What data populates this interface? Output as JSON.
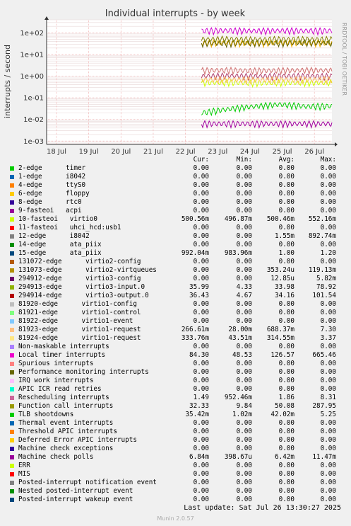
{
  "chart_data": {
    "type": "line",
    "title": "Individual interrupts - by week",
    "ylabel": "interrupts / second",
    "side_text": "RRDTOOL / TOBI OETIKER",
    "y_scale": "log",
    "ylim": [
      0.0007,
      400
    ],
    "y_ticks": [
      {
        "value": 100,
        "label": "1e+02"
      },
      {
        "value": 10,
        "label": "1e+01"
      },
      {
        "value": 1,
        "label": "1e+00"
      },
      {
        "value": 0.1,
        "label": "1e-01"
      },
      {
        "value": 0.01,
        "label": "1e-02"
      },
      {
        "value": 0.001,
        "label": "1e-03"
      }
    ],
    "x_ticks": [
      "18 Jul",
      "19 Jul",
      "20 Jul",
      "21 Jul",
      "22 Jul",
      "23 Jul",
      "24 Jul",
      "25 Jul",
      "26 Jul"
    ],
    "grid": true,
    "data_start": "22 Jul 12:00",
    "series": [
      {
        "name": "10-fasteoi virtio0",
        "color": "#ccff00",
        "values": [
          0.5,
          0.52,
          0.49,
          0.51,
          0.5,
          0.5
        ]
      },
      {
        "name": "15-edge ata_piix",
        "color": "#b04070",
        "values": [
          1.0,
          1.05,
          0.98,
          1.02,
          1.0,
          1.0
        ]
      },
      {
        "name": "294913-edge virtio3-input.0",
        "color": "#f0b000",
        "values": [
          34,
          35,
          33,
          36,
          34,
          34
        ]
      },
      {
        "name": "294914-edge virtio3-output.0",
        "color": "#606000",
        "values": [
          34,
          33,
          35,
          34,
          36,
          34
        ]
      },
      {
        "name": "81923-edge virtio1-request",
        "color": "#ffc060",
        "values": [
          0.69,
          0.7,
          0.68,
          0.69,
          0.7,
          0.69
        ]
      },
      {
        "name": "Local timer interrupts",
        "color": "#cc00cc",
        "values": [
          126,
          130,
          125,
          128,
          126,
          126
        ]
      },
      {
        "name": "Rescheduling interrupts",
        "color": "#d07070",
        "values": [
          1.86,
          1.9,
          1.8,
          1.85,
          1.9,
          1.86
        ]
      },
      {
        "name": "Function call interrupts",
        "color": "#808000",
        "values": [
          50,
          52,
          49,
          51,
          50,
          50
        ]
      },
      {
        "name": "TLB shootdowns",
        "color": "#00cc00",
        "values": [
          0.02,
          0.03,
          0.04,
          0.05,
          0.04,
          0.042
        ]
      },
      {
        "name": "Machine check polls",
        "color": "#a000a0",
        "values": [
          0.0064,
          0.0064,
          0.0064,
          0.0064,
          0.0064,
          0.0064
        ]
      }
    ]
  },
  "legend": {
    "headers": [
      "Cur:",
      "Min:",
      "Avg:",
      "Max:"
    ],
    "rows": [
      {
        "name": "2-edge      timer",
        "color": "#00cc00",
        "cur": "0.00",
        "min": "0.00",
        "avg": "0.00",
        "max": "0.00"
      },
      {
        "name": "1-edge      i8042",
        "color": "#0066b3",
        "cur": "0.00",
        "min": "0.00",
        "avg": "0.00",
        "max": "0.00"
      },
      {
        "name": "4-edge      ttyS0",
        "color": "#ff8000",
        "cur": "0.00",
        "min": "0.00",
        "avg": "0.00",
        "max": "0.00"
      },
      {
        "name": "6-edge      floppy",
        "color": "#ffcc00",
        "cur": "0.00",
        "min": "0.00",
        "avg": "0.00",
        "max": "0.00"
      },
      {
        "name": "8-edge      rtc0",
        "color": "#330099",
        "cur": "0.00",
        "min": "0.00",
        "avg": "0.00",
        "max": "0.00"
      },
      {
        "name": "9-fasteoi   acpi",
        "color": "#990099",
        "cur": "0.00",
        "min": "0.00",
        "avg": "0.00",
        "max": "0.00"
      },
      {
        "name": "10-fasteoi   virtio0",
        "color": "#ccff00",
        "cur": "500.56m",
        "min": "496.87m",
        "avg": "500.46m",
        "max": "552.16m"
      },
      {
        "name": "11-fasteoi   uhci_hcd:usb1",
        "color": "#ff0000",
        "cur": "0.00",
        "min": "0.00",
        "avg": "0.00",
        "max": "0.00"
      },
      {
        "name": "12-edge      i8042",
        "color": "#808080",
        "cur": "0.00",
        "min": "0.00",
        "avg": "1.55m",
        "max": "892.74m"
      },
      {
        "name": "14-edge      ata_piix",
        "color": "#008f00",
        "cur": "0.00",
        "min": "0.00",
        "avg": "0.00",
        "max": "0.00"
      },
      {
        "name": "15-edge      ata_piix",
        "color": "#00487d",
        "cur": "992.04m",
        "min": "983.96m",
        "avg": "1.00",
        "max": "1.20"
      },
      {
        "name": "131072-edge      virtio2-config",
        "color": "#b35a00",
        "cur": "0.00",
        "min": "0.00",
        "avg": "0.00",
        "max": "0.00"
      },
      {
        "name": "131073-edge      virtio2-virtqueues",
        "color": "#b38f00",
        "cur": "0.00",
        "min": "0.00",
        "avg": "353.24u",
        "max": "119.13m"
      },
      {
        "name": "294912-edge      virtio3-config",
        "color": "#6b006b",
        "cur": "0.00",
        "min": "0.00",
        "avg": "12.85u",
        "max": "5.82m"
      },
      {
        "name": "294913-edge      virtio3-input.0",
        "color": "#8fb300",
        "cur": "35.99",
        "min": "4.33",
        "avg": "33.98",
        "max": "78.92"
      },
      {
        "name": "294914-edge      virtio3-output.0",
        "color": "#b30000",
        "cur": "36.43",
        "min": "4.67",
        "avg": "34.16",
        "max": "101.54"
      },
      {
        "name": "81920-edge      virtio1-config",
        "color": "#bebebe",
        "cur": "0.00",
        "min": "0.00",
        "avg": "0.00",
        "max": "0.00"
      },
      {
        "name": "81921-edge      virtio1-control",
        "color": "#80ff80",
        "cur": "0.00",
        "min": "0.00",
        "avg": "0.00",
        "max": "0.00"
      },
      {
        "name": "81922-edge      virtio1-event",
        "color": "#80c9ff",
        "cur": "0.00",
        "min": "0.00",
        "avg": "0.00",
        "max": "0.00"
      },
      {
        "name": "81923-edge      virtio1-request",
        "color": "#ffc080",
        "cur": "266.61m",
        "min": "28.00m",
        "avg": "688.37m",
        "max": "7.30"
      },
      {
        "name": "81924-edge      virtio1-request",
        "color": "#ffe680",
        "cur": "333.76m",
        "min": "43.51m",
        "avg": "314.55m",
        "max": "3.37"
      },
      {
        "name": "Non-maskable interrupts",
        "color": "#aa80ff",
        "cur": "0.00",
        "min": "0.00",
        "avg": "0.00",
        "max": "0.00"
      },
      {
        "name": "Local timer interrupts",
        "color": "#ee00cc",
        "cur": "84.30",
        "min": "48.53",
        "avg": "126.57",
        "max": "665.46"
      },
      {
        "name": "Spurious interrupts",
        "color": "#ff8080",
        "cur": "0.00",
        "min": "0.00",
        "avg": "0.00",
        "max": "0.00"
      },
      {
        "name": "Performance monitoring interrupts",
        "color": "#666600",
        "cur": "0.00",
        "min": "0.00",
        "avg": "0.00",
        "max": "0.00"
      },
      {
        "name": "IRQ work interrupts",
        "color": "#ffbfff",
        "cur": "0.00",
        "min": "0.00",
        "avg": "0.00",
        "max": "0.00"
      },
      {
        "name": "APIC ICR read retries",
        "color": "#00ffcc",
        "cur": "0.00",
        "min": "0.00",
        "avg": "0.00",
        "max": "0.00"
      },
      {
        "name": "Rescheduling interrupts",
        "color": "#cc6699",
        "cur": "1.49",
        "min": "952.46m",
        "avg": "1.86",
        "max": "8.31"
      },
      {
        "name": "Function call interrupts",
        "color": "#999900",
        "cur": "32.33",
        "min": "9.84",
        "avg": "50.08",
        "max": "287.95"
      },
      {
        "name": "TLB shootdowns",
        "color": "#00cc00",
        "cur": "35.42m",
        "min": "1.02m",
        "avg": "42.02m",
        "max": "5.25"
      },
      {
        "name": "Thermal event interrupts",
        "color": "#0066b3",
        "cur": "0.00",
        "min": "0.00",
        "avg": "0.00",
        "max": "0.00"
      },
      {
        "name": "Threshold APIC interrupts",
        "color": "#ff8000",
        "cur": "0.00",
        "min": "0.00",
        "avg": "0.00",
        "max": "0.00"
      },
      {
        "name": "Deferred Error APIC interrupts",
        "color": "#ffcc00",
        "cur": "0.00",
        "min": "0.00",
        "avg": "0.00",
        "max": "0.00"
      },
      {
        "name": "Machine check exceptions",
        "color": "#330099",
        "cur": "0.00",
        "min": "0.00",
        "avg": "0.00",
        "max": "0.00"
      },
      {
        "name": "Machine check polls",
        "color": "#990099",
        "cur": "6.84m",
        "min": "398.67u",
        "avg": "6.42m",
        "max": "11.47m"
      },
      {
        "name": "ERR",
        "color": "#ccff00",
        "cur": "0.00",
        "min": "0.00",
        "avg": "0.00",
        "max": "0.00"
      },
      {
        "name": "MIS",
        "color": "#ff0000",
        "cur": "0.00",
        "min": "0.00",
        "avg": "0.00",
        "max": "0.00"
      },
      {
        "name": "Posted-interrupt notification event",
        "color": "#808080",
        "cur": "0.00",
        "min": "0.00",
        "avg": "0.00",
        "max": "0.00"
      },
      {
        "name": "Nested posted-interrupt event",
        "color": "#008f00",
        "cur": "0.00",
        "min": "0.00",
        "avg": "0.00",
        "max": "0.00"
      },
      {
        "name": "Posted-interrupt wakeup event",
        "color": "#00487d",
        "cur": "0.00",
        "min": "0.00",
        "avg": "0.00",
        "max": "0.00"
      }
    ]
  },
  "footer": {
    "last_update": "Last update: Sat Jul 26 13:30:27 2025",
    "munin": "Munin 2.0.57"
  }
}
